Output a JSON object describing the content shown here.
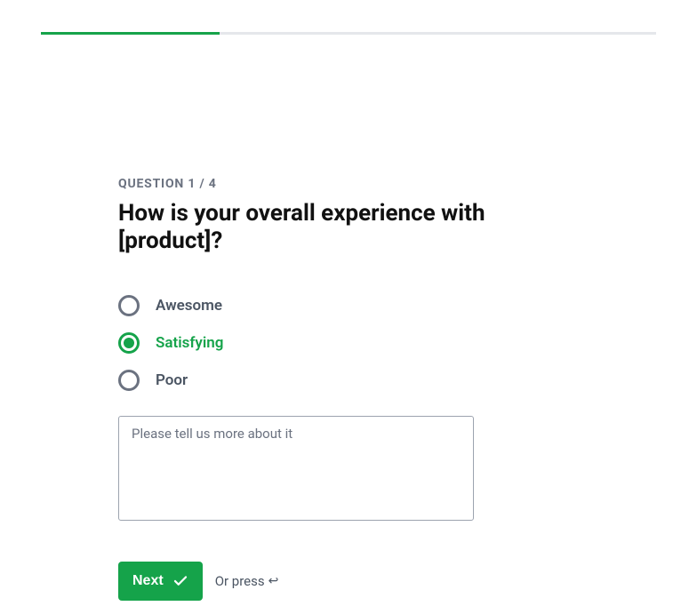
{
  "colors": {
    "accent": "#15a34a",
    "progress_bg": "#e5e7eb",
    "text_muted": "#6b7280",
    "text_body": "#4b5563",
    "text_dark": "#111"
  },
  "progress": {
    "current": 1,
    "total": 4,
    "percent": 29
  },
  "question": {
    "counter": "QUESTION 1 / 4",
    "title": "How is your overall experience with [product]?",
    "options": [
      {
        "label": "Awesome",
        "selected": false
      },
      {
        "label": "Satisfying",
        "selected": true
      },
      {
        "label": "Poor",
        "selected": false
      }
    ],
    "textarea": {
      "placeholder": "Please tell us more about it",
      "value": ""
    }
  },
  "actions": {
    "next_label": "Next",
    "hint_prefix": "Or press",
    "hint_key_glyph": "↩"
  }
}
